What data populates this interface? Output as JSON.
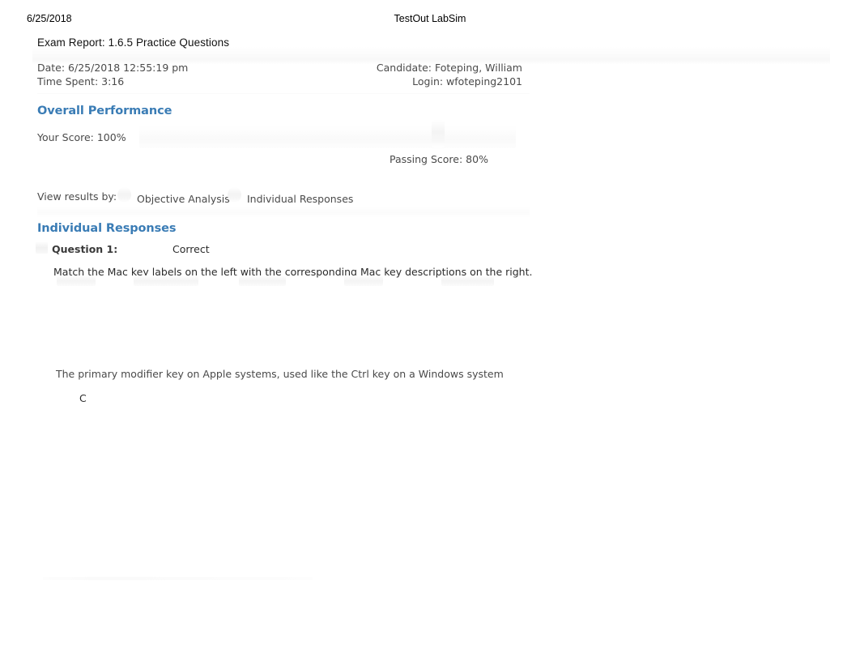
{
  "print_header": {
    "date": "6/25/2018",
    "app_title": "TestOut LabSim"
  },
  "report": {
    "title": "Exam Report: 1.6.5 Practice Questions",
    "meta": {
      "date_label": "Date: 6/25/2018 12:55:19 pm",
      "time_spent_label": "Time Spent: 3:16",
      "candidate_label": "Candidate: Foteping, William",
      "login_label": "Login: wfoteping2101"
    }
  },
  "overall_performance": {
    "heading": "Overall Performance",
    "your_score_label": "Your Score:  100%",
    "passing_score_label": "Passing Score:  80%",
    "score_value": 100,
    "passing_value": 80,
    "heading_color": "#3a7cb5"
  },
  "view_results": {
    "label": "View results by:",
    "options": [
      {
        "label": "Objective Analysis",
        "icon": "radio-unselected-icon"
      },
      {
        "label": "Individual Responses",
        "icon": "radio-selected-icon"
      }
    ],
    "selected": "Individual Responses"
  },
  "individual_responses": {
    "heading": "Individual Responses",
    "questions": [
      {
        "number_label": "Question 1:",
        "status": "Correct",
        "prompt": "Match the Mac key labels on the left with the corresponding Mac key descriptions on the right.",
        "answers": [
          {
            "description": "The primary modifier key on Apple systems, used like the Ctrl key on a Windows system",
            "value": "C"
          }
        ]
      }
    ]
  },
  "colors": {
    "accent_blue": "#3a7cb5",
    "body_text": "#4a4a4a",
    "strong_text": "#2b2b2b",
    "page_background": "#ffffff"
  }
}
